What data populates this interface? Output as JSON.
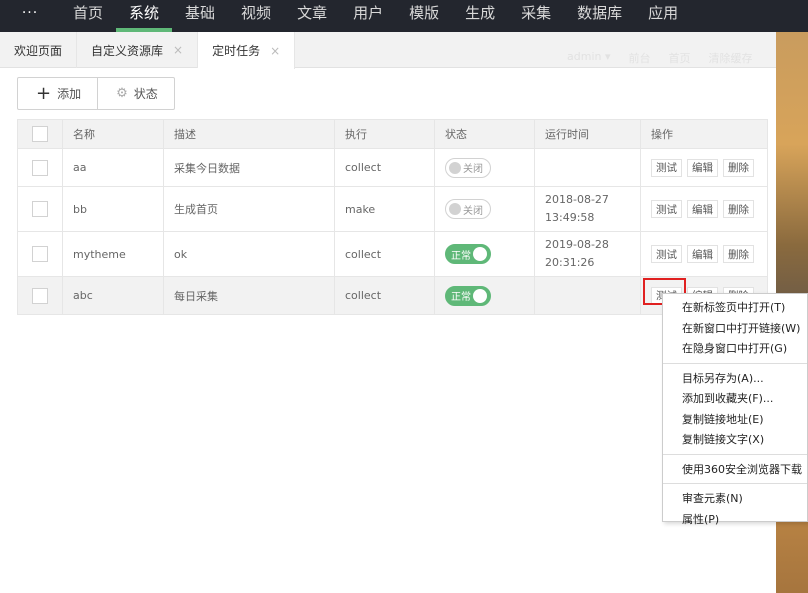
{
  "topnav": {
    "more_label": "···",
    "items": [
      {
        "label": "首页",
        "active": false
      },
      {
        "label": "系统",
        "active": true
      },
      {
        "label": "基础",
        "active": false
      },
      {
        "label": "视频",
        "active": false
      },
      {
        "label": "文章",
        "active": false
      },
      {
        "label": "用户",
        "active": false
      },
      {
        "label": "模版",
        "active": false
      },
      {
        "label": "生成",
        "active": false
      },
      {
        "label": "采集",
        "active": false
      },
      {
        "label": "数据库",
        "active": false
      },
      {
        "label": "应用",
        "active": false
      }
    ]
  },
  "tabs": [
    {
      "label": "欢迎页面",
      "closable": false,
      "active": false
    },
    {
      "label": "自定义资源库",
      "closable": true,
      "active": false
    },
    {
      "label": "定时任务",
      "closable": true,
      "active": true
    }
  ],
  "tab_close_glyph": "×",
  "faint_user": {
    "name": "admin ▾",
    "links": [
      "前台",
      "首页",
      "清除缓存"
    ]
  },
  "toolbar": {
    "add_label": "添加",
    "status_label": "状态"
  },
  "table": {
    "headers": [
      "名称",
      "描述",
      "执行",
      "状态",
      "运行时间",
      "操作"
    ],
    "rows": [
      {
        "name": "aa",
        "desc": "采集今日数据",
        "exec": "collect",
        "status": "关闭",
        "on": false,
        "time1": "",
        "time2": ""
      },
      {
        "name": "bb",
        "desc": "生成首页",
        "exec": "make",
        "status": "关闭",
        "on": false,
        "time1": "2018-08-27",
        "time2": "13:49:58"
      },
      {
        "name": "mytheme",
        "desc": "ok",
        "exec": "collect",
        "status": "正常",
        "on": true,
        "time1": "2019-08-28",
        "time2": "20:31:26"
      },
      {
        "name": "abc",
        "desc": "每日采集",
        "exec": "collect",
        "status": "正常",
        "on": true,
        "time1": "",
        "time2": ""
      }
    ],
    "ops": [
      "测试",
      "编辑",
      "删除"
    ]
  },
  "context_menu": {
    "groups": [
      [
        "在新标签页中打开(T)",
        "在新窗口中打开链接(W)",
        "在隐身窗口中打开(G)"
      ],
      [
        "目标另存为(A)...",
        "添加到收藏夹(F)...",
        "复制链接地址(E)",
        "复制链接文字(X)"
      ],
      [
        "使用360安全浏览器下载"
      ],
      [
        "审查元素(N)",
        "属性(P)"
      ]
    ]
  },
  "colors": {
    "accent": "#5fb878",
    "nav_bg": "#23262e",
    "highlight": "#e02020"
  }
}
